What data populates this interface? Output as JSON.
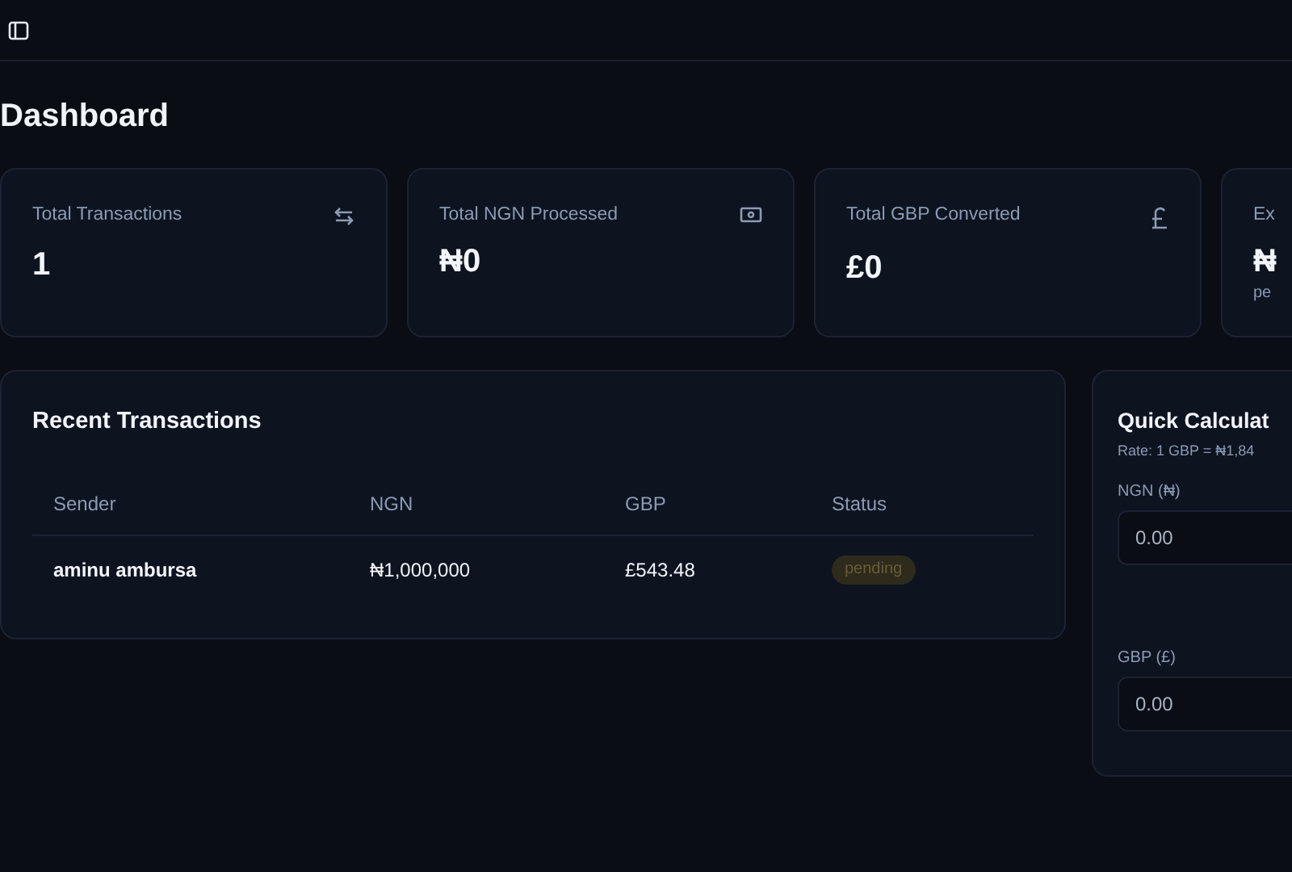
{
  "page_title": "Dashboard",
  "stats": [
    {
      "label": "Total Transactions",
      "value": "1"
    },
    {
      "label": "Total NGN Processed",
      "value": "₦0"
    },
    {
      "label": "Total GBP Converted",
      "value": "£0"
    },
    {
      "label": "Ex",
      "value": "₦",
      "note": "pe"
    }
  ],
  "recent_transactions": {
    "title": "Recent Transactions",
    "columns": [
      "Sender",
      "NGN",
      "GBP",
      "Status"
    ],
    "rows": [
      {
        "sender": "aminu ambursa",
        "ngn": "₦1,000,000",
        "gbp": "£543.48",
        "status": "pending"
      }
    ]
  },
  "quick_calculator": {
    "title": "Quick Calculat",
    "rate": "Rate: 1 GBP = ₦1,84",
    "fields": [
      {
        "label": "NGN (₦)",
        "placeholder": "0.00"
      },
      {
        "label": "GBP (£)",
        "placeholder": "0.00"
      }
    ]
  }
}
